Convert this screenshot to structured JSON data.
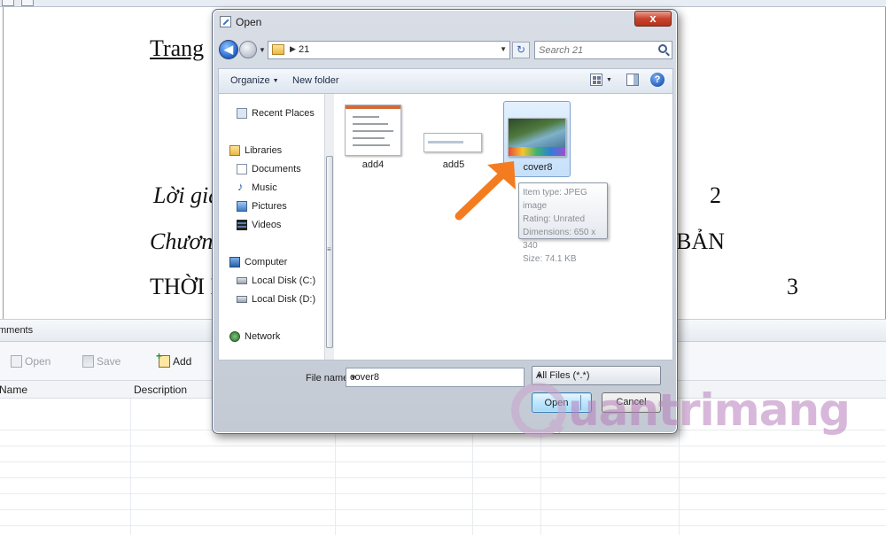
{
  "document": {
    "title": "Trang",
    "line1_left": "Lời giả",
    "line1_right": "2",
    "line2_left": "Chương",
    "line2_right": "BẢN",
    "line3_left": "THỜI K",
    "line3_right": "3"
  },
  "panel": {
    "title": "mments",
    "toolbar": {
      "open": "Open",
      "save": "Save",
      "add": "Add"
    },
    "columns": {
      "name": "Name",
      "description": "Description"
    }
  },
  "dialog": {
    "title": "Open",
    "close": "x",
    "address": {
      "path": "21"
    },
    "search": {
      "placeholder": "Search 21"
    },
    "command_bar": {
      "organize": "Organize",
      "new_folder": "New folder",
      "help": "?"
    },
    "nav": {
      "recent_places": "Recent Places",
      "libraries": "Libraries",
      "documents": "Documents",
      "music": "Music",
      "pictures": "Pictures",
      "videos": "Videos",
      "computer": "Computer",
      "local_disk_c": "Local Disk (C:)",
      "local_disk_d": "Local Disk (D:)",
      "network": "Network"
    },
    "files": [
      {
        "name": "add4"
      },
      {
        "name": "add5"
      },
      {
        "name": "cover8",
        "selected": true
      }
    ],
    "tooltip": {
      "item_type": "Item type: JPEG image",
      "rating": "Rating: Unrated",
      "dimensions": "Dimensions: 650 x 340",
      "size": "Size: 74.1 KB"
    },
    "file_name_label": "File name:",
    "file_name_value": "cover8",
    "file_type": "All Files (*.*)",
    "open_button": "Open",
    "cancel_button": "Cancel"
  },
  "watermark": {
    "text": "uantrimang"
  },
  "colors": {
    "arrow": "#f47c20",
    "selection": "#c6e0fa",
    "watermark": "#b77fbc"
  }
}
